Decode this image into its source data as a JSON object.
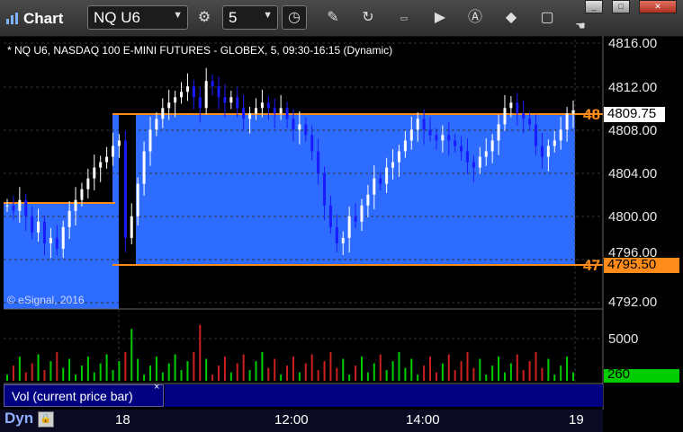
{
  "toolbar": {
    "title": "Chart",
    "symbol": "NQ U6",
    "interval": "5",
    "icons": [
      "gear-icon",
      "clock-icon",
      "pencil-icon",
      "refresh-icon",
      "get-icon",
      "play-icon",
      "alert-icon",
      "diamond-icon",
      "chat-icon",
      "cursor-icon"
    ]
  },
  "window_buttons": [
    "minimize",
    "maximize",
    "close"
  ],
  "symbol_description": "* NQ U6, NASDAQ 100 E-MINI FUTURES - GLOBEX, 5, 09:30-16:15 (Dynamic)",
  "copyright": "© eSignal, 2016",
  "colors": {
    "background": "#000000",
    "zone_fill": "#2d6cff",
    "line_orange": "#ff8c1a",
    "up_bar": "#ffffff",
    "down_bar": "#1a1aff",
    "vol_up": "#00cc00",
    "vol_down": "#cc2020",
    "panel_band": "#000080",
    "volume_tag": "#00cc00"
  },
  "price_axis": {
    "labels": [
      "4816.00",
      "4812.00",
      "4808.00",
      "4804.00",
      "4800.00",
      "4796.00",
      "4792.00"
    ],
    "current_price": "4809.75",
    "upper_line_label": "48",
    "lower_line_label": "47",
    "lower_line_tag": "4795.50"
  },
  "volume_axis": {
    "label": "5000",
    "current_volume": "260"
  },
  "volume_panel": {
    "title": "Vol (current price bar)",
    "close_glyph": "×"
  },
  "time_axis": {
    "mode": "Dyn",
    "labels": [
      "18",
      "12:00",
      "14:00",
      "19"
    ]
  },
  "chart_data": {
    "type": "candlestick",
    "price_range": [
      4792,
      4817
    ],
    "horizontal_levels": [
      4809.75,
      4795.5
    ],
    "previous_session_level": 4801.25,
    "volume_range": [
      0,
      7000
    ]
  }
}
